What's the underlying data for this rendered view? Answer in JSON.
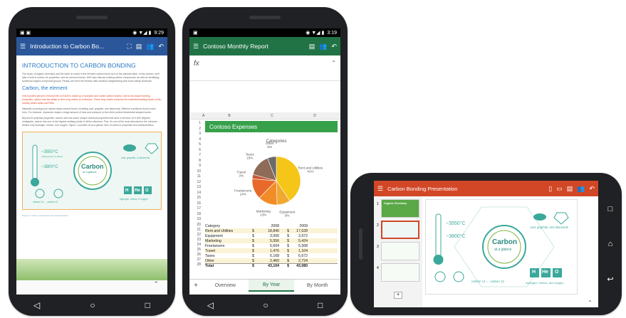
{
  "word": {
    "status_time": "9:29",
    "doc_title": "Introduction to Carbon Bo...",
    "heading": "INTRODUCTION TO CARBON BONDING",
    "subheading": "Carbon, the element",
    "body_1": "The study of organic chemistry and the earth is rooted in the element carbon found as 6 of the periodic table. In this section, we'll take a look at carbon, its properties, and its common bonds. We'll also discuss existing carbon compounds, as well as identifying functional organic compound groups. Finally, we'll end the session with structure diagramming and some handy shortcuts.",
    "body_2": "One hundred percent of known life on Earth is made up of complex and varied carbon chains. Due to its unique bonding properties, carbon has the ability to form long chains of molecules. These long chains comprise the essential building blocks of life, namely amino acids and RNA.",
    "body_3": "Naturally occurring pure carbon takes several forms, including coal, graphite, and diamonds. Different conditions lead to each form. For instance, diamonds require a large amount of heat and pressure to form their perfect tetrahedral shaped bonds.",
    "body_4": "Beyond its physical properties, carbon also has some unique chemical properties that work in its favor. At 3,500 degrees centigrade, carbon has one of the highest melting points of all the elements. Plus, it's one of the most abundant in the universe – behind only hydrogen, helium, and oxygen. Figure 1 provides an at a glance view of carbon's properties and characteristics.",
    "figure_caption": "Figure 1: Carbon compounds and characteristics",
    "infographic": {
      "title": "Carbon",
      "subtitle": "at a glance",
      "temp_high": "~3550°C",
      "temp_high_note": "melting point of carbon",
      "temp_low": "~3800°C",
      "forms": "coal, graphite, & diamonds",
      "isotopes": "carbon 14 → carbon 12",
      "elements": [
        "H",
        "He",
        "O"
      ],
      "elements_note": "hydrogen, helium, & oxygen"
    }
  },
  "excel": {
    "status_time": "3:19",
    "doc_title": "Contoso Monthly Report",
    "fx_label": "fx",
    "columns": [
      "A",
      "B",
      "C",
      "D"
    ],
    "rows_numbers": [
      "1",
      "2",
      "3",
      "4",
      "5",
      "6",
      "7",
      "8",
      "9",
      "10",
      "11",
      "12",
      "13",
      "14",
      "15",
      "16",
      "17",
      "18",
      "19",
      "20",
      "21",
      "22",
      "23",
      "24",
      "25",
      "26",
      "27",
      "28"
    ],
    "sheet_title": "Contoso Expenses",
    "chart_title": "Categories",
    "table_header": {
      "category": "Category",
      "y1": "2008",
      "y2": "2009"
    },
    "rows": [
      {
        "cat": "Rent and Utilities",
        "c1": "$",
        "v1": "18,840",
        "c2": "$",
        "v2": "17,628"
      },
      {
        "cat": "Equipment",
        "c1": "$",
        "v1": "3,000",
        "c2": "$",
        "v2": "3,972"
      },
      {
        "cat": "Marketing",
        "c1": "$",
        "v1": "5,556",
        "c2": "$",
        "v2": "5,424"
      },
      {
        "cat": "Freelancers",
        "c1": "$",
        "v1": "5,604",
        "c2": "$",
        "v2": "5,568"
      },
      {
        "cat": "Travel",
        "c1": "$",
        "v1": "1,476",
        "c2": "$",
        "v2": "1,104"
      },
      {
        "cat": "Taxes",
        "c1": "$",
        "v1": "6,168",
        "c2": "$",
        "v2": "6,672"
      },
      {
        "cat": "Other",
        "c1": "$",
        "v1": "2,460",
        "c2": "$",
        "v2": "2,724"
      },
      {
        "cat": "Total",
        "c1": "$",
        "v1": "43,104",
        "c2": "$",
        "v2": "43,080"
      }
    ],
    "tabs": [
      "Overview",
      "By Year",
      "By Month"
    ],
    "add_tab": "+"
  },
  "chart_data": {
    "type": "pie",
    "title": "Categories",
    "categories": [
      "Rent and Utilities",
      "Equipment",
      "Marketing",
      "Freelancers",
      "Travel",
      "Taxes",
      "Other"
    ],
    "values": [
      41,
      9,
      13,
      14,
      3,
      15,
      6
    ],
    "labels": [
      "Rent and Utilities\n41%",
      "Equipment\n9%",
      "Marketing\n13%",
      "Freelancers\n14%",
      "Travel\n3%",
      "Taxes\n15%",
      "Other\n6%"
    ],
    "colors": [
      "#f5c518",
      "#f0a830",
      "#f28c28",
      "#e86a2a",
      "#c85a3a",
      "#8e6a58",
      "#6b6b6b"
    ]
  },
  "ppt": {
    "doc_title": "Carbon Bonding Presentation",
    "slide_numbers": [
      "1",
      "2",
      "3",
      "4"
    ],
    "thumb1_title": "Organic Chemistry",
    "temp_high": "~3550°C",
    "temp_low": "~3800°C",
    "carbon_title": "Carbon",
    "carbon_subtitle": "at a glance",
    "forms": "coal, graphite, and diamonds",
    "isotopes": "carbon 14 → carbon 12",
    "elements": [
      "H",
      "He",
      "O"
    ],
    "elements_note": "hydrogen, helium, and oxygen",
    "add_slide": "+"
  },
  "colors": {
    "word": "#2b579a",
    "excel": "#217346",
    "ppt": "#d24726",
    "teal": "#3aa89a",
    "green": "#7cb342"
  }
}
